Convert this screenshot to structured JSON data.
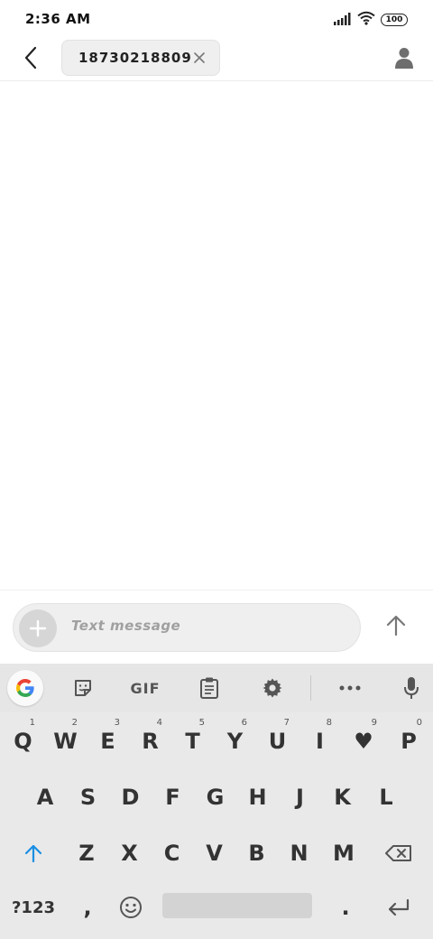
{
  "status_bar": {
    "time": "2:36 AM",
    "battery": "100",
    "signal_icon": "signal-icon",
    "wifi_icon": "wifi-icon"
  },
  "header": {
    "back_icon": "back-arrow-icon",
    "recipient": "18730218809",
    "remove_icon": "close-icon",
    "contact_icon": "person-icon"
  },
  "compose": {
    "add_icon": "plus-icon",
    "placeholder": "Text message",
    "send_icon": "arrow-up-icon"
  },
  "keyboard": {
    "toolbar": {
      "google_icon": "google-g-icon",
      "sticker_icon": "sticker-icon",
      "gif_label": "GIF",
      "clipboard_icon": "clipboard-icon",
      "settings_icon": "gear-icon",
      "more_icon": "more-dots-icon",
      "mic_icon": "microphone-icon"
    },
    "row1": [
      {
        "label": "Q",
        "hint": "1"
      },
      {
        "label": "W",
        "hint": "2"
      },
      {
        "label": "E",
        "hint": "3"
      },
      {
        "label": "R",
        "hint": "4"
      },
      {
        "label": "T",
        "hint": "5"
      },
      {
        "label": "Y",
        "hint": "6"
      },
      {
        "label": "U",
        "hint": "7"
      },
      {
        "label": "I",
        "hint": "8"
      },
      {
        "label": "♥",
        "hint": "9"
      },
      {
        "label": "P",
        "hint": "0"
      }
    ],
    "row2": [
      "A",
      "S",
      "D",
      "F",
      "G",
      "H",
      "J",
      "K",
      "L"
    ],
    "row3": [
      "Z",
      "X",
      "C",
      "V",
      "B",
      "N",
      "M"
    ],
    "shift_icon": "shift-arrow-icon",
    "backspace_icon": "backspace-icon",
    "symbols_label": "?123",
    "comma_label": ",",
    "emoji_icon": "emoji-icon",
    "period_label": ".",
    "enter_icon": "enter-icon"
  },
  "colors": {
    "accent": "#1a8fe3",
    "key_text": "#333333",
    "keyboard_bg": "#e9e9e9"
  }
}
